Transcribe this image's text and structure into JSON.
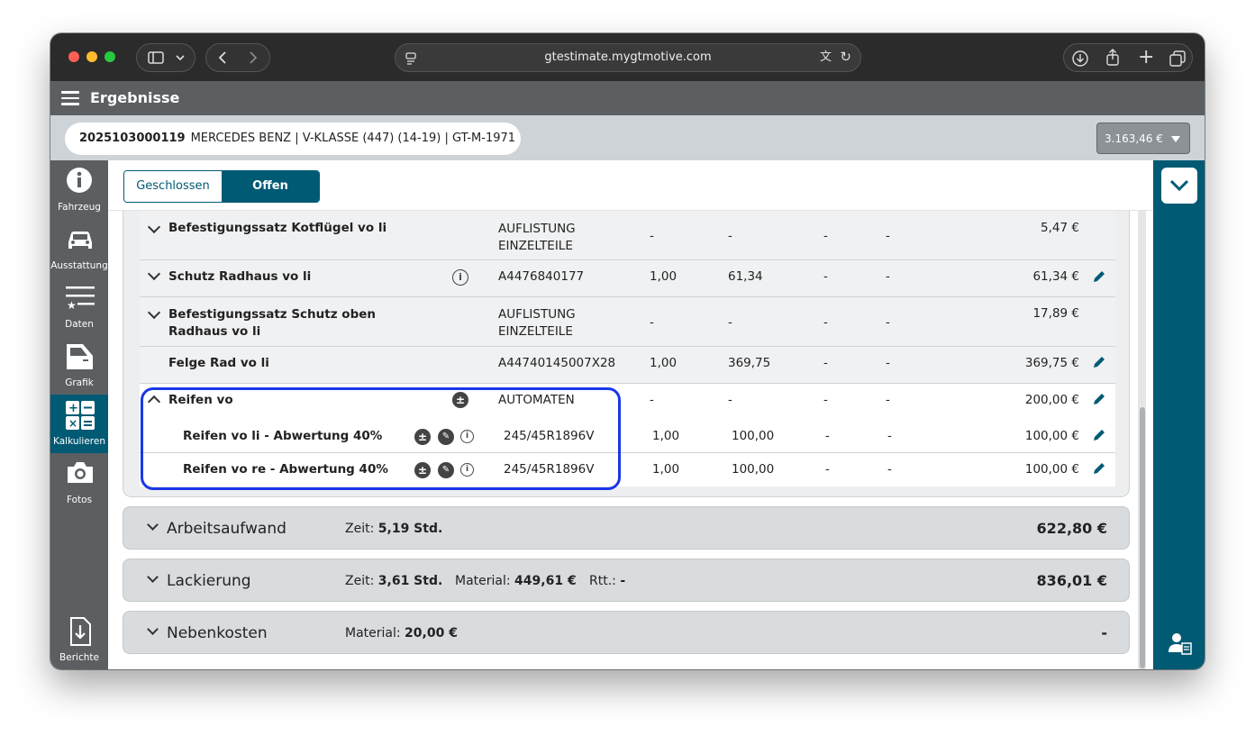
{
  "browser": {
    "url": "gtestimate.mygtmotive.com"
  },
  "header": {
    "title": "Ergebnisse"
  },
  "vehicle": {
    "id": "2025103000119",
    "desc": "MERCEDES BENZ | V-KLASSE (447) (14-19) | GT-M-1971"
  },
  "price_badge": "3.163,46 €",
  "nav": [
    {
      "label": "Fahrzeug"
    },
    {
      "label": "Ausstattung"
    },
    {
      "label": "Daten"
    },
    {
      "label": "Grafik"
    },
    {
      "label": "Kalkulieren"
    },
    {
      "label": "Fotos"
    },
    {
      "label": "Berichte"
    }
  ],
  "tabs": [
    {
      "label": "Geschlossen"
    },
    {
      "label": "Offen"
    }
  ],
  "rows": [
    {
      "name": "Befestigungssatz Kotflügel vo li",
      "part": "AUFLISTUNG EINZELTEILE",
      "qty": "-",
      "price": "-",
      "c1": "-",
      "c2": "-",
      "total": "5,47 €"
    },
    {
      "name": "Schutz Radhaus vo li",
      "part": "A4476840177",
      "qty": "1,00",
      "price": "61,34",
      "c1": "-",
      "c2": "-",
      "total": "61,34 €"
    },
    {
      "name": "Befestigungssatz Schutz oben Radhaus vo li",
      "part": "AUFLISTUNG EINZELTEILE",
      "qty": "-",
      "price": "-",
      "c1": "-",
      "c2": "-",
      "total": "17,89 €"
    },
    {
      "name": "Felge Rad vo li",
      "part": "A44740145007X28",
      "qty": "1,00",
      "price": "369,75",
      "c1": "-",
      "c2": "-",
      "total": "369,75 €"
    },
    {
      "name": "Reifen vo",
      "part": "AUTOMATEN",
      "qty": "-",
      "price": "-",
      "c1": "-",
      "c2": "-",
      "total": "200,00 €"
    },
    {
      "name": "Reifen vo li - Abwertung 40%",
      "part": "245/45R1896V",
      "qty": "1,00",
      "price": "100,00",
      "c1": "-",
      "c2": "-",
      "total": "100,00 €"
    },
    {
      "name": "Reifen vo re - Abwertung 40%",
      "part": "245/45R1896V",
      "qty": "1,00",
      "price": "100,00",
      "c1": "-",
      "c2": "-",
      "total": "100,00 €"
    }
  ],
  "sections": [
    {
      "title": "Arbeitsaufwand",
      "m1_label": "Zeit:",
      "m1_value": "5,19 Std.",
      "total": "622,80 €"
    },
    {
      "title": "Lackierung",
      "m1_label": "Zeit:",
      "m1_value": "3,61 Std.",
      "m2_label": "Material:",
      "m2_value": "449,61 €",
      "m3_label": "Rtt.:",
      "m3_value": "-",
      "total": "836,01 €"
    },
    {
      "title": "Nebenkosten",
      "m1_label": "Material:",
      "m1_value": "20,00 €",
      "total": "-"
    }
  ],
  "colors": {
    "accent": "#005a74",
    "highlight": "#1a37e8",
    "header": "#5b5f62"
  }
}
